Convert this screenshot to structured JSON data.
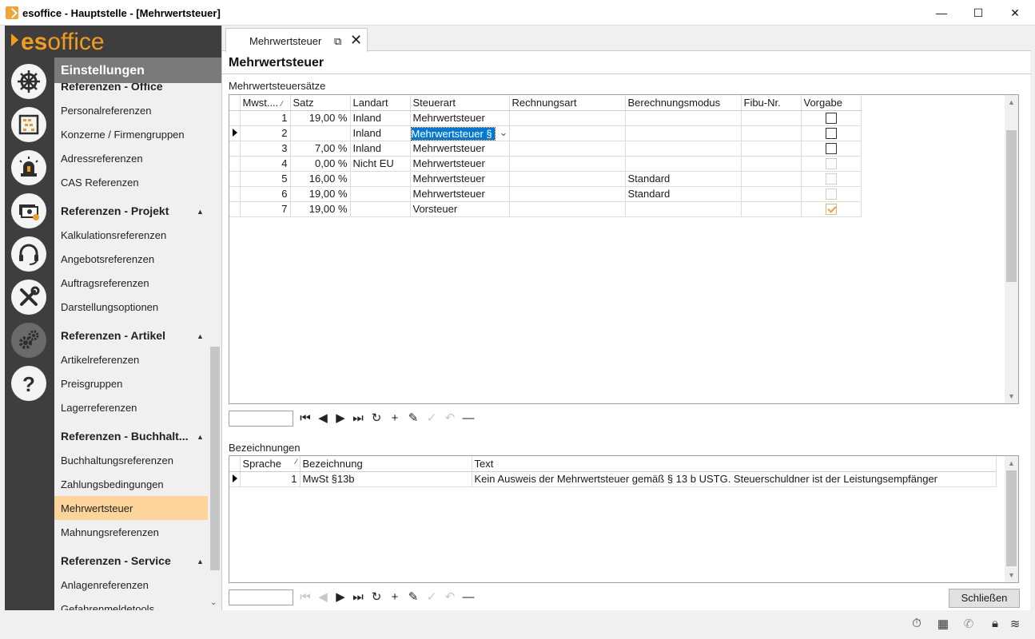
{
  "window": {
    "title": "esoffice - Hauptstelle - [Mehrwertsteuer]",
    "minimize": "—",
    "maximize": "☐",
    "close": "✕"
  },
  "logo": {
    "es": "es",
    "office": "office"
  },
  "sidebar": {
    "header": "Einstellungen",
    "sections": [
      {
        "title": "Referenzen - Office",
        "items": [
          "Personalreferenzen",
          "Konzerne / Firmengruppen",
          "Adressreferenzen",
          "CAS Referenzen"
        ]
      },
      {
        "title": "Referenzen - Projekt",
        "items": [
          "Kalkulationsreferenzen",
          "Angebotsreferenzen",
          "Auftragsreferenzen",
          "Darstellungsoptionen"
        ]
      },
      {
        "title": "Referenzen - Artikel",
        "items": [
          "Artikelreferenzen",
          "Preisgruppen",
          "Lagerreferenzen"
        ]
      },
      {
        "title": "Referenzen - Buchhalt...",
        "items": [
          "Buchhaltungsreferenzen",
          "Zahlungsbedingungen",
          "Mehrwertsteuer",
          "Mahnungsreferenzen"
        ]
      },
      {
        "title": "Referenzen - Service",
        "items": [
          "Anlagenreferenzen",
          "Gefahrenmeldetools"
        ]
      }
    ],
    "selected": "Mehrwertsteuer",
    "icons": [
      "ship-wheel-icon",
      "abacus-icon",
      "alarm-light-icon",
      "money-icon",
      "headset-icon",
      "tools-icon",
      "gears-icon",
      "help-icon"
    ]
  },
  "tab": {
    "label": "Mehrwertsteuer"
  },
  "page": {
    "title": "Mehrwertsteuer"
  },
  "rates": {
    "label": "Mehrwertsteuersätze",
    "columns": [
      "Mwst....",
      "Satz",
      "Landart",
      "Steuerart",
      "Rechnungsart",
      "Berechnungsmodus",
      "Fibu-Nr.",
      "Vorgabe"
    ],
    "rows": [
      {
        "mwst": "1",
        "satz": "19,00 %",
        "landart": "Inland",
        "steuerart": "Mehrwertsteuer",
        "rechnungsart": "",
        "modus": "",
        "fibu": "",
        "vorgabe": "empty"
      },
      {
        "mwst": "2",
        "satz": "",
        "landart": "Inland",
        "steuerart": "Mehrwertsteuer §",
        "rechnungsart": "",
        "modus": "",
        "fibu": "",
        "vorgabe": "empty"
      },
      {
        "mwst": "3",
        "satz": "7,00 %",
        "landart": "Inland",
        "steuerart": "Mehrwertsteuer",
        "rechnungsart": "",
        "modus": "",
        "fibu": "",
        "vorgabe": "empty"
      },
      {
        "mwst": "4",
        "satz": "0,00 %",
        "landart": "Nicht EU",
        "steuerart": "Mehrwertsteuer",
        "rechnungsart": "",
        "modus": "",
        "fibu": "",
        "vorgabe": "disabled"
      },
      {
        "mwst": "5",
        "satz": "16,00 %",
        "landart": "",
        "steuerart": "Mehrwertsteuer",
        "rechnungsart": "",
        "modus": "Standard",
        "fibu": "",
        "vorgabe": "disabled"
      },
      {
        "mwst": "6",
        "satz": "19,00 %",
        "landart": "",
        "steuerart": "Mehrwertsteuer",
        "rechnungsart": "",
        "modus": "Standard",
        "fibu": "",
        "vorgabe": "disabled"
      },
      {
        "mwst": "7",
        "satz": "19,00 %",
        "landart": "",
        "steuerart": "Vorsteuer",
        "rechnungsart": "",
        "modus": "",
        "fibu": "",
        "vorgabe": "checked"
      }
    ],
    "current_row": 1
  },
  "descriptions": {
    "label": "Bezeichnungen",
    "columns": [
      "Sprache",
      "Bezeichnung",
      "Text"
    ],
    "rows": [
      {
        "sprache": "1",
        "bezeichnung": "MwSt §13b",
        "text": "Kein Ausweis der Mehrwertsteuer gemäß § 13 b USTG. Steuerschuldner ist der Leistungsempfänger"
      }
    ]
  },
  "close_button": "Schließen",
  "colors": {
    "accent": "#f29c1f",
    "sidebar_dark": "#3e3e3e",
    "selected_nav": "#fdd59a",
    "selection": "#0078d7"
  }
}
